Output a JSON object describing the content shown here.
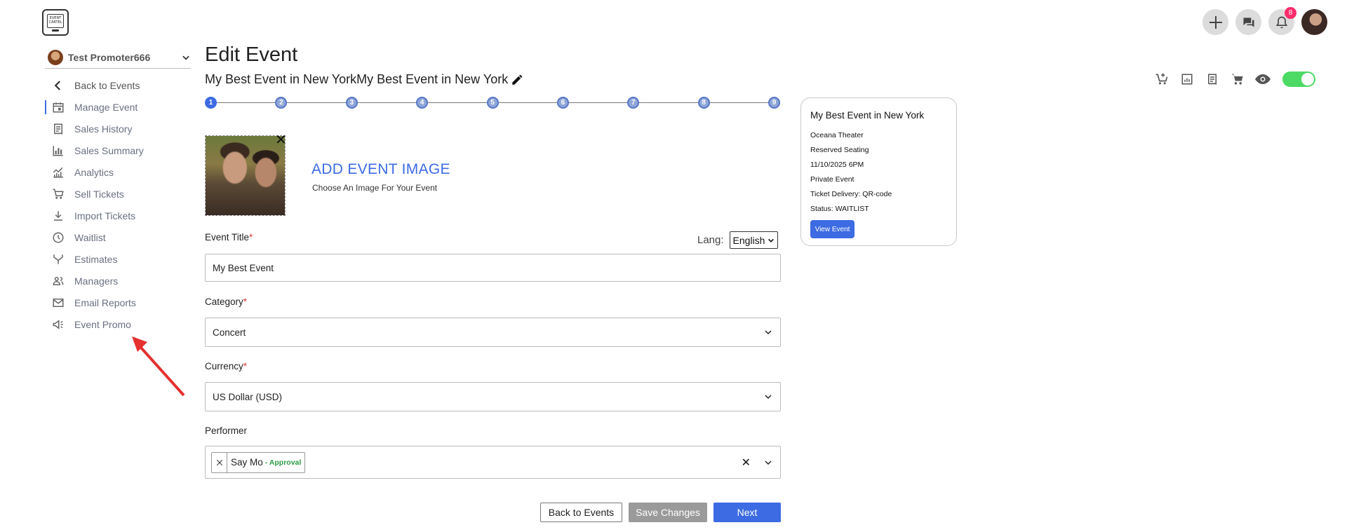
{
  "logo": {
    "text": "EVENT CARTEL"
  },
  "notifications": {
    "count": "8"
  },
  "sidebar": {
    "promoter_name": "Test Promoter666",
    "items": [
      {
        "label": "Back to Events",
        "icon": "chevron-left-icon"
      },
      {
        "label": "Manage Event",
        "icon": "calendar-icon"
      },
      {
        "label": "Sales History",
        "icon": "receipt-icon"
      },
      {
        "label": "Sales Summary",
        "icon": "bar-chart-icon"
      },
      {
        "label": "Analytics",
        "icon": "analytics-icon"
      },
      {
        "label": "Sell Tickets",
        "icon": "cart-icon"
      },
      {
        "label": "Import Tickets",
        "icon": "download-icon"
      },
      {
        "label": "Waitlist",
        "icon": "clock-icon"
      },
      {
        "label": "Estimates",
        "icon": "merge-icon"
      },
      {
        "label": "Managers",
        "icon": "people-icon"
      },
      {
        "label": "Email Reports",
        "icon": "mail-icon"
      },
      {
        "label": "Event Promo",
        "icon": "megaphone-icon"
      }
    ],
    "active_index": 1
  },
  "main": {
    "page_title": "Edit Event",
    "event_name": "My Best Event in New YorkMy Best Event in New York",
    "steps": [
      "1",
      "2",
      "3",
      "4",
      "5",
      "6",
      "7",
      "8",
      "9"
    ],
    "active_step": 0,
    "add_image_title": "ADD EVENT IMAGE",
    "add_image_sub": "Choose An Image For Your Event",
    "lang_label": "Lang:",
    "lang_value": "English",
    "event_title_label": "Event Title",
    "event_title_value": "My Best Event",
    "category_label": "Category",
    "category_value": "Concert",
    "currency_label": "Currency",
    "currency_value": "US Dollar (USD)",
    "performer_label": "Performer",
    "performer_chip": "Say Mo",
    "performer_chip_status": "- Approval",
    "required_mark": "*",
    "buttons": {
      "back": "Back to Events",
      "save": "Save Changes",
      "next": "Next"
    }
  },
  "preview_card": {
    "title": "My Best Event in New York",
    "venue": "Oceana Theater",
    "seating": "Reserved Seating",
    "datetime": "11/10/2025 6PM",
    "privacy": "Private Event",
    "delivery": "Ticket Delivery: QR-code",
    "status": "Status: WAITLIST",
    "button": "View Event"
  },
  "colors": {
    "accent": "#3c6be3",
    "approval": "#2a9d45",
    "toggle_on": "#4cd964",
    "badge": "#ff2d6b",
    "arrow": "#e53030"
  },
  "toggle_on": true
}
